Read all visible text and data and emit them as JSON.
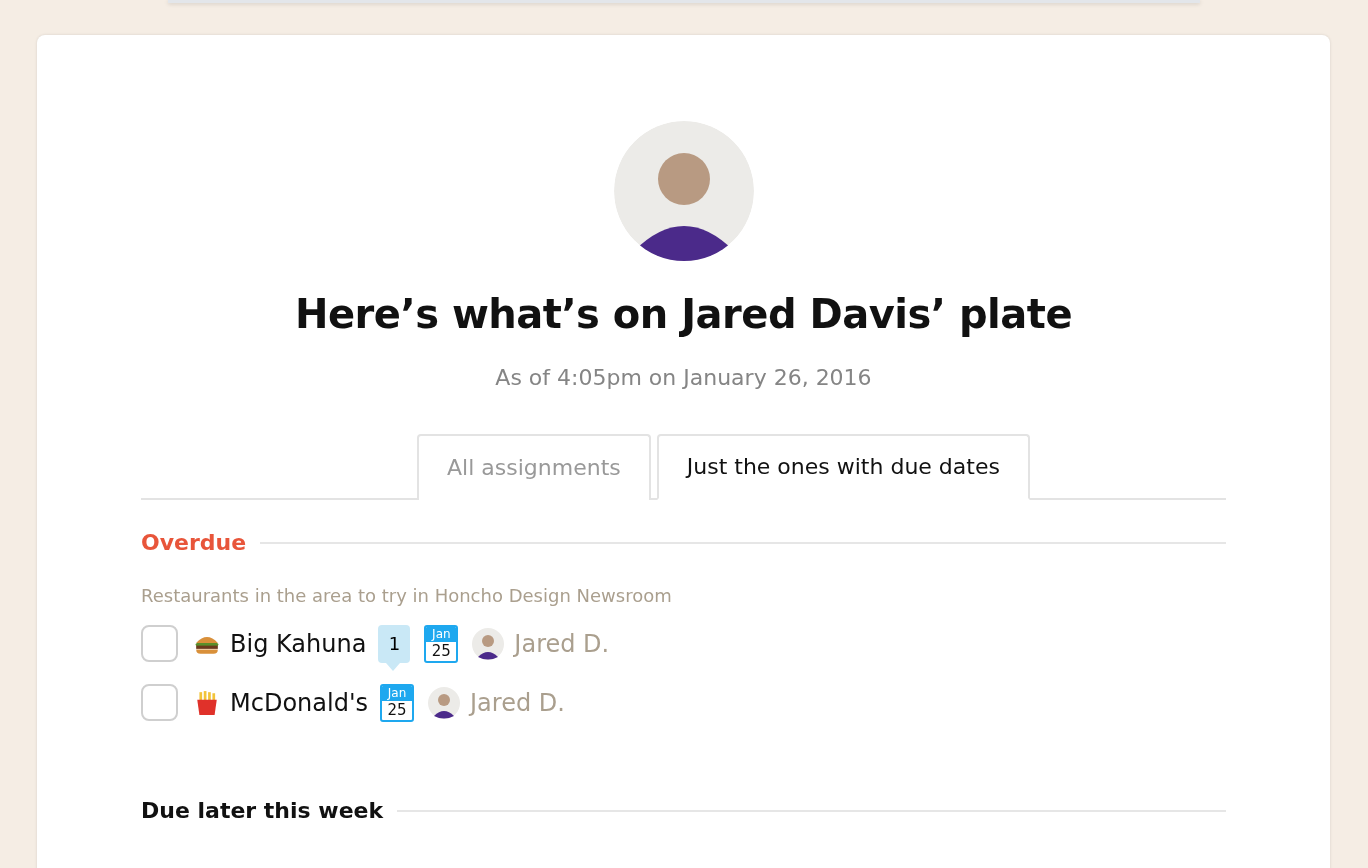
{
  "title": "Here’s what’s on Jared Davis’ plate",
  "subtitle": "As of 4:05pm on January 26, 2016",
  "tabs": [
    {
      "label": "All assignments",
      "selected": false
    },
    {
      "label": "Just the ones with due dates",
      "selected": true
    }
  ],
  "sections": [
    {
      "heading": "Overdue",
      "kind": "overdue",
      "groups": [
        {
          "project": "Restaurants in the area to try in Honcho Design Newsroom",
          "tasks": [
            {
              "kind": "burger",
              "checked": false,
              "name": "Big Kahuna",
              "comments": "1",
              "due_month": "Jan",
              "due_day": "25",
              "assignee": "Jared D."
            },
            {
              "kind": "fries",
              "checked": false,
              "name": "McDonald's",
              "due_month": "Jan",
              "due_day": "25",
              "assignee": "Jared D."
            }
          ]
        }
      ]
    },
    {
      "heading": "Due later this week",
      "kind": "later"
    }
  ]
}
